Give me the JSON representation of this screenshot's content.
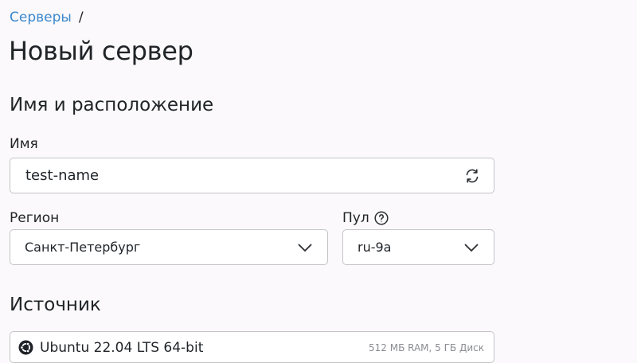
{
  "breadcrumb": {
    "parent": "Серверы",
    "separator": "/"
  },
  "page": {
    "title": "Новый сервер"
  },
  "sections": {
    "location_title": "Имя и расположение",
    "source_title": "Источник"
  },
  "fields": {
    "name": {
      "label": "Имя",
      "value": "test-name",
      "icon": "refresh-icon"
    },
    "region": {
      "label": "Регион",
      "selected": "Санкт-Петербург",
      "icon": "chevron-down-icon"
    },
    "pool": {
      "label": "Пул",
      "help_icon": "help-circle-icon",
      "selected": "ru-9a",
      "icon": "chevron-down-icon"
    }
  },
  "source": {
    "os_name": "Ubuntu 22.04 LTS 64-bit",
    "specs": "512 МБ RAM, 5 ГБ Диск",
    "icon": "ubuntu-icon"
  },
  "colors": {
    "link": "#3b88cc",
    "background": "#fbf9fb",
    "border": "#c4c4c8"
  }
}
